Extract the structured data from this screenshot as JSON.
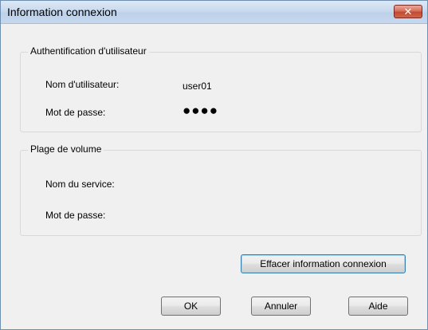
{
  "window": {
    "title": "Information connexion",
    "close_glyph": "✕"
  },
  "user_auth": {
    "legend": "Authentification d'utilisateur",
    "username_label": "Nom d'utilisateur:",
    "username_value": "user01",
    "password_label": "Mot de passe:",
    "password_value": "●●●●"
  },
  "volume_range": {
    "legend": "Plage de volume",
    "service_label": "Nom du service:",
    "password_label": "Mot de passe:"
  },
  "buttons": {
    "clear": "Effacer information connexion",
    "ok": "OK",
    "cancel": "Annuler",
    "help": "Aide"
  },
  "colors": {
    "close_button": "#c24a31",
    "focus_border": "#3c7fb1"
  }
}
